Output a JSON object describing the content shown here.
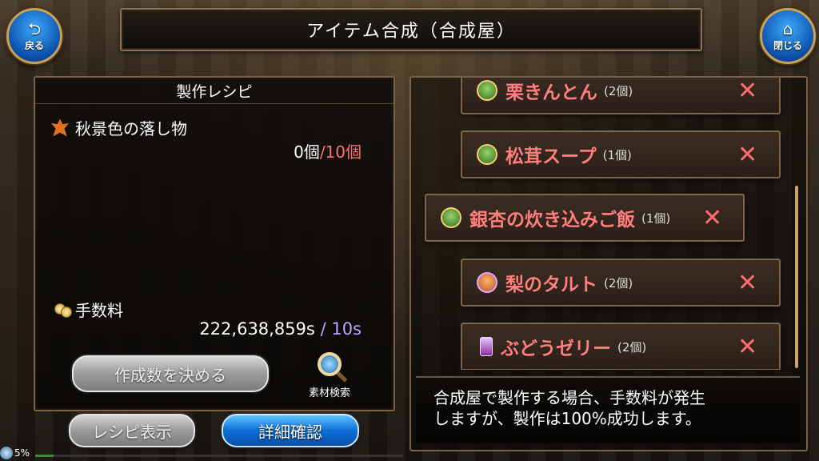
{
  "title": "アイテム合成（合成屋）",
  "nav": {
    "back_label": "戻る",
    "close_label": "閉じる"
  },
  "left_panel": {
    "heading": "製作レシピ",
    "material_name": "秋景色の落し物",
    "material_owned": "0個",
    "material_required": "/10個",
    "fee_label": "手数料",
    "fee_owned": "222,638,859s",
    "fee_separator": "/",
    "fee_required": "10s",
    "decide_button": "作成数を決める",
    "search_label": "素材検索",
    "recipe_button": "レシピ表示",
    "detail_button": "詳細確認"
  },
  "recipes": [
    {
      "name": "栗きんとん",
      "count": "(2個)",
      "icon": "pot-icon"
    },
    {
      "name": "松茸スープ",
      "count": "(1個)",
      "icon": "pot-icon"
    },
    {
      "name": "銀杏の炊き込みご飯",
      "count": "(1個)",
      "icon": "pot-icon"
    },
    {
      "name": "梨のタルト",
      "count": "(2個)",
      "icon": "tart-icon"
    },
    {
      "name": "ぶどうゼリー",
      "count": "(2個)",
      "icon": "bottle-icon"
    }
  ],
  "recipe_mark": "✕",
  "message": {
    "line1": "合成屋で製作する場合、手数料が発生",
    "line2": "しますが、製作は100%成功します。"
  },
  "status": {
    "percent": "5%",
    "progress": 0.05
  },
  "colors": {
    "accent_red": "#ff7f7f",
    "accent_blue": "#b6a7ff",
    "button_blue": "#0c6fd6"
  }
}
